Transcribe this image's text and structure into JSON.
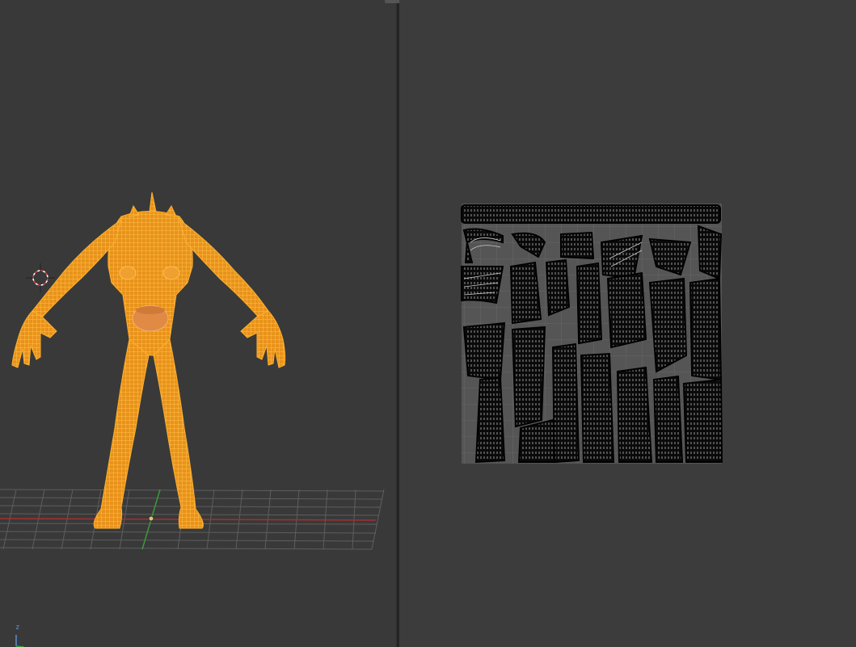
{
  "window": {
    "layout": "split-view",
    "colors": {
      "background": "#3a3a3a",
      "mesh_selected": "#f5a623",
      "uv_island": "#0a0a0a",
      "uv_grid": "#5a5a5a",
      "x_axis": "#b03030",
      "y_axis": "#3a9a3a"
    }
  },
  "viewport_3d": {
    "object_selected": true,
    "axis_gizmo_label": "z",
    "shading": "wireframe"
  },
  "uv_editor": {
    "content": "uv-islands-layout"
  }
}
